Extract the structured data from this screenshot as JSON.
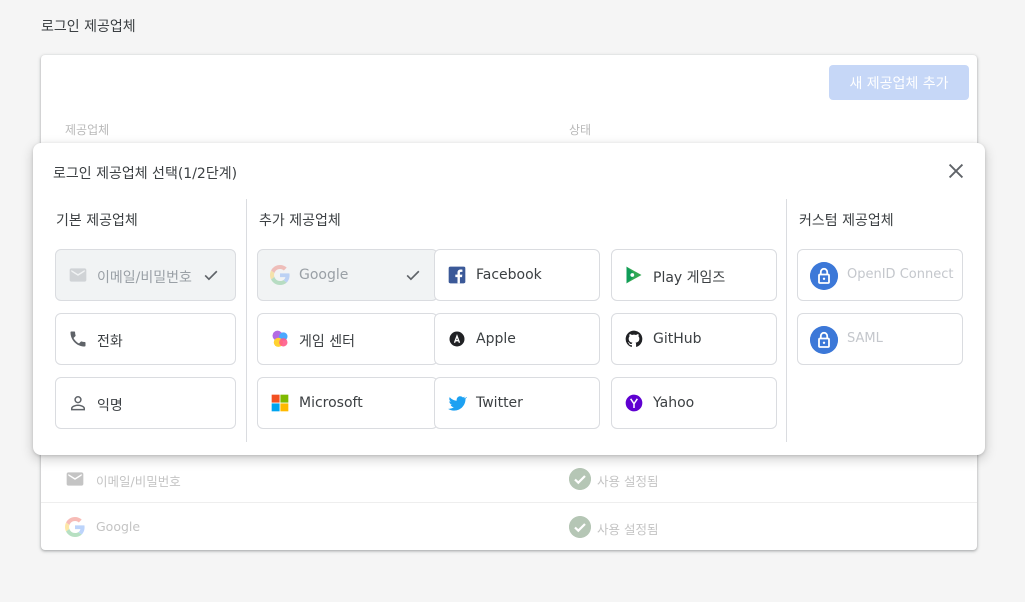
{
  "page": {
    "title": "로그인 제공업체"
  },
  "card": {
    "add_button": "새 제공업체 추가",
    "col_provider": "제공업체",
    "col_status": "상태",
    "rows": [
      {
        "name": "이메일/비밀번호",
        "status": "사용 설정됨",
        "icon": "mail-icon"
      },
      {
        "name": "Google",
        "status": "사용 설정됨",
        "icon": "google-icon"
      }
    ]
  },
  "modal": {
    "title": "로그인 제공업체 선택(1/2단계)",
    "groups": {
      "basic": "기본 제공업체",
      "additional": "추가 제공업체",
      "custom": "커스텀 제공업체"
    },
    "basic": [
      {
        "label": "이메일/비밀번호",
        "icon": "mail-icon",
        "selected": true
      },
      {
        "label": "전화",
        "icon": "phone-icon",
        "selected": false
      },
      {
        "label": "익명",
        "icon": "person-icon",
        "selected": false
      }
    ],
    "additional": [
      {
        "label": "Google",
        "icon": "google-icon",
        "selected": true
      },
      {
        "label": "Facebook",
        "icon": "facebook-icon"
      },
      {
        "label": "Play 게임즈",
        "icon": "play-games-icon"
      },
      {
        "label": "게임 센터",
        "icon": "game-center-icon"
      },
      {
        "label": "Apple",
        "icon": "apple-icon"
      },
      {
        "label": "GitHub",
        "icon": "github-icon"
      },
      {
        "label": "Microsoft",
        "icon": "microsoft-icon"
      },
      {
        "label": "Twitter",
        "icon": "twitter-icon"
      },
      {
        "label": "Yahoo",
        "icon": "yahoo-icon"
      }
    ],
    "custom": [
      {
        "label": "OpenID Connect",
        "icon": "lock-icon",
        "disabled": true
      },
      {
        "label": "SAML",
        "icon": "lock-icon",
        "disabled": true
      }
    ]
  },
  "colors": {
    "accent": "#3c78d8",
    "add_button_bg": "#c6d7f7",
    "facebook": "#3b5998",
    "twitter": "#1da1f2",
    "yahoo": "#5f01d1"
  }
}
